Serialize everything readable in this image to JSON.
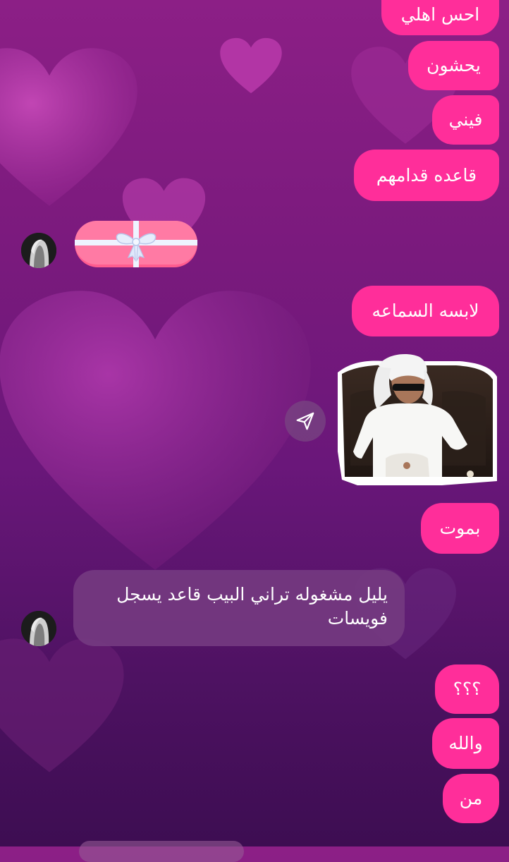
{
  "messages": {
    "out_1": "احس اهلي",
    "out_2": "يحشون",
    "out_3": "فيني",
    "out_4": "قاعده قدامهم",
    "out_5": "لابسه السماعه",
    "out_6": "بموت",
    "in_1": "يليل مشغوله تراني البيب قاعد يسجل فويسات",
    "out_7": "؟؟؟",
    "out_8": "والله",
    "out_9": "من"
  },
  "icons": {
    "gift": "gift-icon",
    "forward": "forward-icon",
    "avatar": "avatar"
  },
  "colors": {
    "outgoing_bubble": "#ff2e9a",
    "incoming_bubble": "#743a80",
    "background_top": "#8c1f86",
    "background_bottom": "#3d0d52",
    "gift_ribbon": "#e8f0ff",
    "gift_box": "#ff5c8f"
  }
}
